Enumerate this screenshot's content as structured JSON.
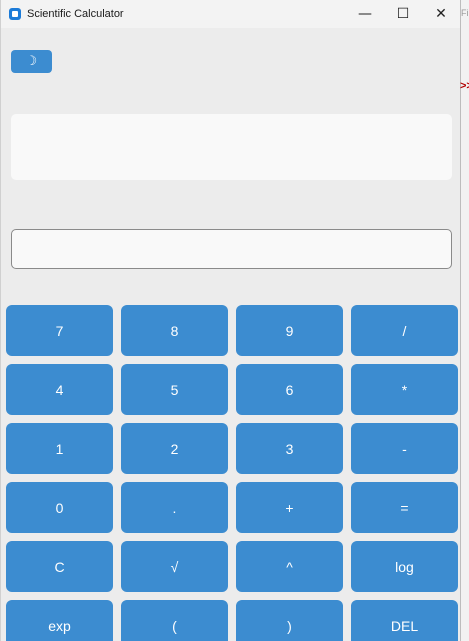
{
  "window": {
    "title": "Scientific Calculator"
  },
  "titlebar_buttons": {
    "minimize": "—",
    "maximize": "☐",
    "close": "✕"
  },
  "toolbar": {
    "theme_icon": "☽"
  },
  "display": {
    "history_text": "",
    "entry_value": ""
  },
  "keys": [
    [
      "7",
      "8",
      "9",
      "/"
    ],
    [
      "4",
      "5",
      "6",
      "*"
    ],
    [
      "1",
      "2",
      "3",
      "-"
    ],
    [
      "0",
      ".",
      "+",
      "="
    ],
    [
      "C",
      "√",
      "^",
      "log"
    ],
    [
      "exp",
      "(",
      ")",
      "DEL"
    ]
  ],
  "background_app": {
    "partial_text": "Fi",
    "partial_marker": ">>"
  },
  "colors": {
    "accent": "#3c8cd0",
    "window_bg": "#ececec",
    "field_bg": "#f9f9f9"
  }
}
